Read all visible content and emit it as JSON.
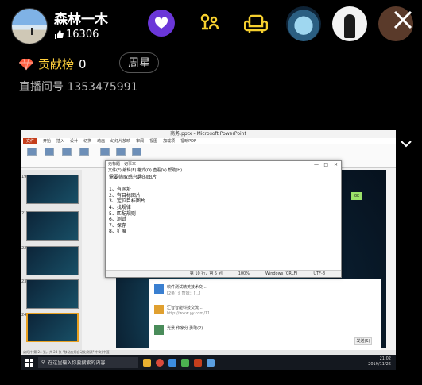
{
  "host": {
    "name": "森林一木",
    "likes": "16306"
  },
  "rank": {
    "label": "贡献榜",
    "value": "0",
    "week_star": "周星"
  },
  "room": {
    "id_label": "直播间号",
    "id": "1353475991"
  },
  "stream": {
    "ppt_title": "商务.pptx - Microsoft PowerPoint",
    "ribbon_tabs": [
      "文件",
      "开始",
      "插入",
      "设计",
      "切换",
      "动画",
      "幻灯片放映",
      "审阅",
      "视图",
      "加载项",
      "福昕PDF"
    ],
    "notepad": {
      "title": "无标题 - 记事本",
      "menu": "文件(F)  编辑(E)  格式(O)  查看(V)  帮助(H)",
      "lines": [
        "需要筛取感兴趣的图片",
        "",
        "1、有网址",
        "2、有目标图片",
        "3、定位目标图片",
        "4、找规律",
        "5、匹配规则",
        "6、测试",
        "7、保存",
        "8、扩展"
      ],
      "status": [
        "第 10 行，第 5 列",
        "100%",
        "Windows (CRLF)",
        "UTF-8"
      ]
    },
    "chat_items": [
      {
        "title": "软件测试精英技术交...",
        "sub": "[2条] 汇智妹：[...]"
      },
      {
        "title": "汇智智能科技交流...",
        "sub": "http://www.yy.com/11..."
      },
      {
        "title": "光景 作家分 勇敢(2)...",
        "sub": ""
      }
    ],
    "send_label": "发送(S)",
    "ok_text": "ok",
    "statusbar": "幻灯片 第 24 张，共 24 张  \"移动应用自动化测试\"  中文(中国)",
    "taskbar": {
      "search_placeholder": "在这里输入你要搜索的内容",
      "time": "21:02",
      "date": "2019/11/26"
    }
  },
  "colors": {
    "rank_gold": "#ffcf3c",
    "purple_button": "#6a36d8",
    "yellow_icon": "#f5cf2e"
  }
}
